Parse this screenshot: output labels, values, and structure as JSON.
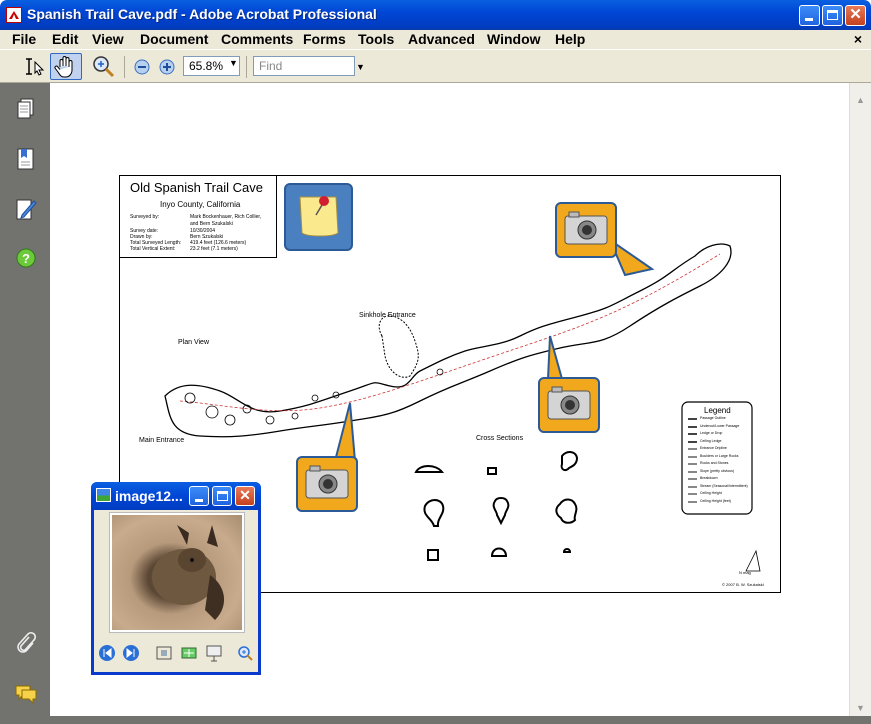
{
  "window": {
    "title": "Spanish Trail Cave.pdf - Adobe Acrobat Professional"
  },
  "menu": {
    "items": [
      "File",
      "Edit",
      "View",
      "Document",
      "Comments",
      "Forms",
      "Tools",
      "Advanced",
      "Window",
      "Help"
    ],
    "close_glyph": "×"
  },
  "toolbar": {
    "zoom_value": "65.8%",
    "find_placeholder": "Find"
  },
  "map": {
    "title": "Old Spanish Trail Cave",
    "subtitle": "Inyo County, California",
    "meta": [
      {
        "label": "Surveyed by:",
        "value": "Mark Bockenhauer, Rich Collier,"
      },
      {
        "label": "",
        "value": "and Bern Szukalski"
      },
      {
        "label": "Survey date:",
        "value": "10/30/2004"
      },
      {
        "label": "Drawn by:",
        "value": "Bern Szukalski"
      },
      {
        "label": "Total Surveyed Length:",
        "value": "419.4 feet (126.6 meters)"
      },
      {
        "label": "Total Vertical Extent:",
        "value": "23.2 feet (7.1 meters)"
      }
    ],
    "labels": {
      "sinkhole": "Sinkhole Entrance",
      "plan_view": "Plan View",
      "main_entrance": "Main Entrance",
      "cross_sections": "Cross Sections",
      "legend": "Legend",
      "north": "N mag",
      "copyright": "© 2007 B. W. Szukalski"
    },
    "legend_items": [
      "Passage Outline",
      "Undercut/Lower Passage",
      "Ledge or Drop",
      "Ceiling Ledge",
      "Entrance Dripline",
      "Boulders or Large Rocks",
      "Rocks and Stones",
      "Slope (pretty obvious)",
      "Breakdown",
      "Stream (Seasonal/Intermittent)",
      "Ceiling Height",
      "Ceiling Height (feet)"
    ]
  },
  "popup": {
    "title": "image12..."
  },
  "sidebar": {
    "icons": [
      "pages-icon",
      "bookmarks-icon",
      "signatures-icon",
      "help-icon",
      "attachments-icon",
      "comments-icon"
    ]
  }
}
